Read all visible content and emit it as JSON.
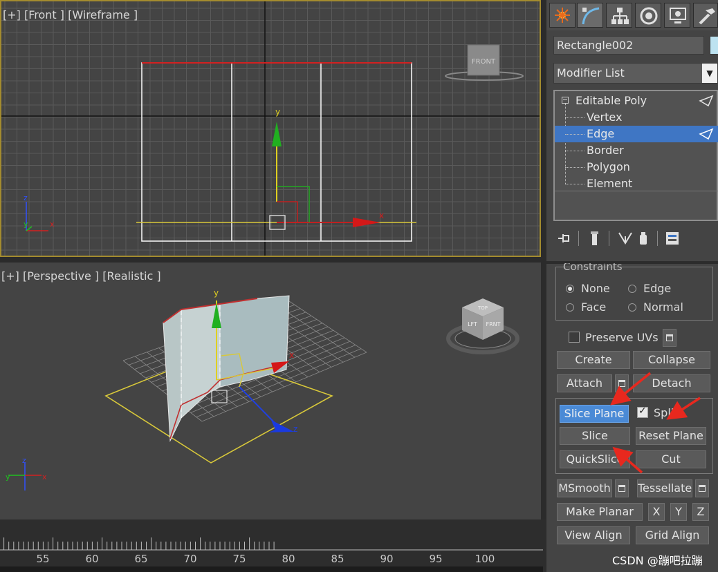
{
  "viewports": {
    "front": {
      "label": "[+] [Front ] [Wireframe ]",
      "viewcube_text": "FRONT",
      "axis_y": "y",
      "axis_x": "x",
      "corner_axis_z": "z",
      "corner_axis_y": "y",
      "corner_axis_x": "x"
    },
    "perspective": {
      "label": "[+] [Perspective ] [Realistic ]",
      "viewcube_text_left": "LFT",
      "viewcube_text_front": "FRNT",
      "viewcube_text_top": "TOP",
      "gizmo_y": "y",
      "gizmo_x": "x",
      "gizmo_z": "z",
      "corner_axis_z": "z",
      "corner_axis_y": "y",
      "corner_axis_x": "x"
    }
  },
  "timeline": {
    "ticks": [
      "55",
      "60",
      "65",
      "70",
      "75",
      "80",
      "85",
      "90",
      "95",
      "100"
    ]
  },
  "panel": {
    "tabs": [
      "create-icon",
      "modify-icon",
      "hierarchy-icon",
      "motion-icon",
      "display-icon",
      "utilities-icon"
    ],
    "object_name": "Rectangle002",
    "object_color": "#bde3f1",
    "modifier_list": "Modifier List",
    "stack": {
      "root": "Editable Poly",
      "items": [
        "Vertex",
        "Edge",
        "Border",
        "Polygon",
        "Element"
      ],
      "selected": "Edge"
    },
    "constraints": {
      "title": "Constraints",
      "none": "None",
      "edge": "Edge",
      "face": "Face",
      "normal": "Normal",
      "selected": "None"
    },
    "preserve_uvs": "Preserve UVs",
    "buttons": {
      "create": "Create",
      "collapse": "Collapse",
      "attach": "Attach",
      "detach": "Detach",
      "slice_plane": "Slice Plane",
      "split": "Split",
      "slice": "Slice",
      "reset_plane": "Reset Plane",
      "quickslice": "QuickSlice",
      "cut": "Cut",
      "msmooth": "MSmooth",
      "tessellate": "Tessellate",
      "make_planar": "Make Planar",
      "x": "X",
      "y": "Y",
      "z": "Z",
      "view_align": "View Align",
      "grid_align": "Grid Align"
    },
    "split_checked": true
  },
  "watermark": "CSDN @蹦吧拉蹦",
  "colors": {
    "viewport_bg": "#444444",
    "active_border": "#a48c2e",
    "selection": "#3f76c4",
    "active_button": "#4a8ad6",
    "annotation_arrow": "#e8281e"
  }
}
